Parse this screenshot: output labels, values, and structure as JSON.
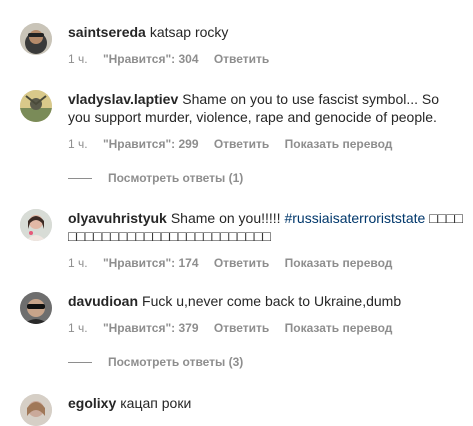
{
  "comments": [
    {
      "username": "saintsereda",
      "text": "katsap rocky",
      "hashtag": "",
      "time": "1 ч.",
      "likes": "\"Нравится\": 304",
      "reply": "Ответить",
      "translate": ""
    },
    {
      "username": "vladyslav.laptiev",
      "text": "Shame on you to use fascist symbol... So you support murder, violence, rape and genocide of people.",
      "hashtag": "",
      "time": "1 ч.",
      "likes": "\"Нравится\": 299",
      "reply": "Ответить",
      "translate": "Показать перевод"
    },
    {
      "username": "olyavuhristyuk",
      "text": "Shame on you!!!!!",
      "hashtag": "#russiaisaterroriststate",
      "text_after": " □□□□ □□□□□□□□□□□□□□□□□□□□□□□□",
      "time": "1 ч.",
      "likes": "\"Нравится\": 174",
      "reply": "Ответить",
      "translate": "Показать перевод"
    },
    {
      "username": "davudioan",
      "text": "Fuck u,never come back to Ukraine,dumb",
      "hashtag": "",
      "time": "1 ч.",
      "likes": "\"Нравится\": 379",
      "reply": "Ответить",
      "translate": "Показать перевод"
    },
    {
      "username": "egolixy",
      "text": "кацап роки"
    }
  ],
  "view_replies": [
    "Посмотреть ответы (1)",
    "Посмотреть ответы (3)"
  ],
  "colors": {
    "text": "#262626",
    "secondary": "#8e8e8e",
    "hashtag": "#00376b"
  }
}
